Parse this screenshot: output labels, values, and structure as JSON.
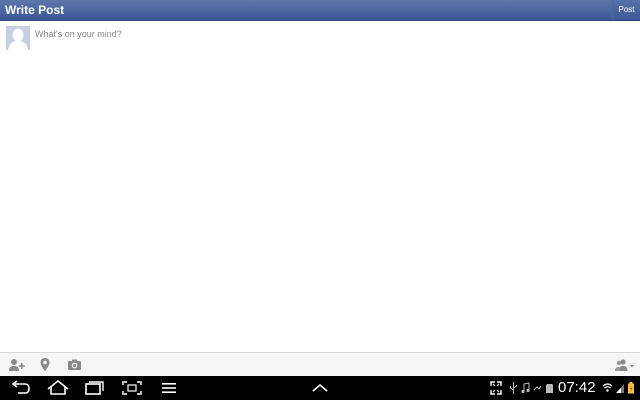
{
  "header": {
    "title": "Write Post",
    "post_label": "Post"
  },
  "composer": {
    "placeholder": "What's on your mind?",
    "value": ""
  },
  "toolbar": {
    "icons": [
      "tag-friends-icon",
      "location-icon",
      "camera-icon",
      "audience-icon"
    ]
  },
  "status_bar": {
    "time": "07:42",
    "icons": [
      "fullscreen-icon",
      "usb-icon",
      "music-icon",
      "signal-icon",
      "sd-card-icon",
      "wifi-icon",
      "cell-signal-icon",
      "battery-icon"
    ]
  },
  "nav_bar": {
    "icons": [
      "back-icon",
      "home-icon",
      "recent-apps-icon",
      "screenshot-icon",
      "menu-icon",
      "chevron-up-icon"
    ]
  },
  "colors": {
    "brand": "#3b5998",
    "header_border": "#29447e",
    "toolbar_bg": "#f6f6f6",
    "icon_gray": "#8a8a8a",
    "battery": "#e8c84a"
  }
}
